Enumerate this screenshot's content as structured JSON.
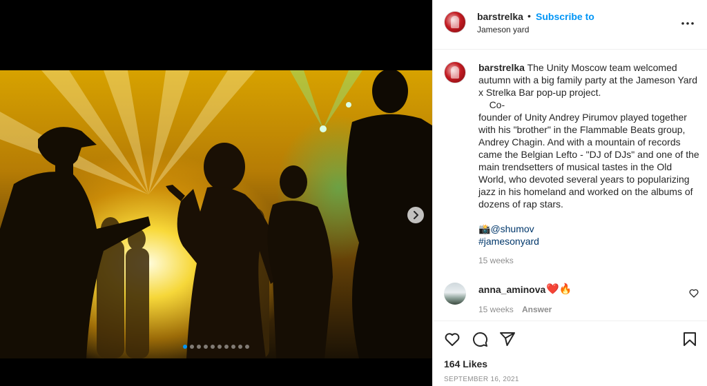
{
  "post": {
    "media": {
      "carousel_count": 10,
      "active_index": 0,
      "next_icon": "chevron-right-icon"
    },
    "header": {
      "username": "barstrelka",
      "separator": "•",
      "subscribe_label": "Subscribe to",
      "location": "Jameson yard",
      "more_icon": "more-options-icon"
    },
    "caption": {
      "username": "barstrelka",
      "text": " The Unity Moscow team welcomed autumn with a big family party at the Jameson Yard x Strelka Bar pop-up project.\n    Co-\nfounder of Unity Andrey Pirumov played together with his \"brother\" in the Flammable Beats group, Andrey Chagin. And with a mountain of records came the Belgian Lefto - \"DJ of DJs\" and one of the main trendsetters of musical tastes in the Old World, who devoted several years to popularizing jazz in his homeland and worked on the albums of dozens of rap stars.\n\n",
      "mention_prefix": "📸",
      "mention": "@shumov",
      "hashtag": "#jamesonyard",
      "time": "15 weeks"
    },
    "comment": {
      "username": "anna_aminova",
      "text": "❤️🔥",
      "time": "15 weeks",
      "answer_label": "Answer"
    },
    "actions": {
      "icons": [
        "heart-icon",
        "comment-icon",
        "share-icon",
        "bookmark-icon"
      ],
      "likes": "164 Likes",
      "date": "SEPTEMBER 16, 2021"
    }
  },
  "colors": {
    "accent": "#0095f6",
    "link": "#00376b",
    "muted": "#8e8e8e",
    "heart": "#ed4956"
  }
}
